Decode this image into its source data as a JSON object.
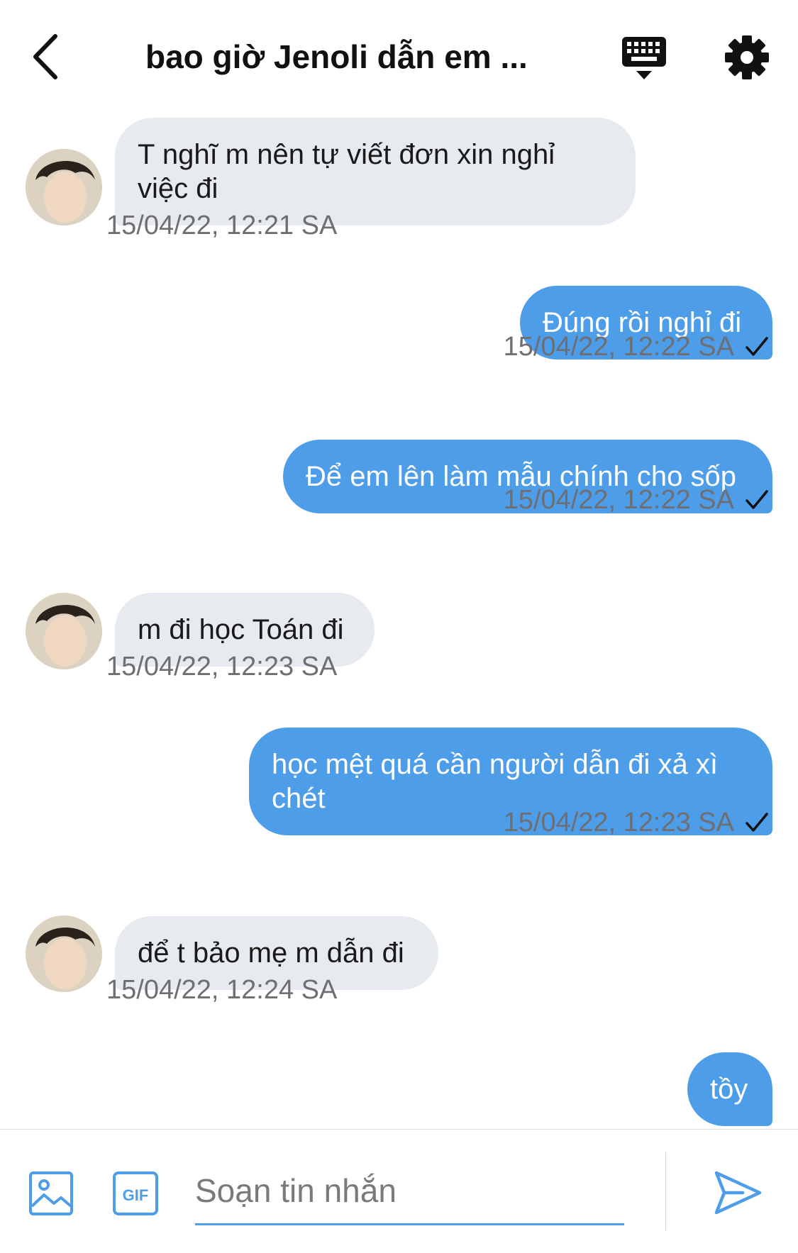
{
  "header": {
    "title": "bao giờ Jenoli dẫn em ...",
    "back_icon": "chevron-left-icon",
    "keyboard_icon": "keyboard-icon",
    "settings_icon": "gear-icon"
  },
  "messages": [
    {
      "direction": "in",
      "text": "T nghĩ m nên tự viết đơn xin nghỉ việc đi",
      "time": "15/04/22, 12:21 SA"
    },
    {
      "direction": "out",
      "text": "Đúng rồi nghỉ đi",
      "time": "15/04/22, 12:22 SA"
    },
    {
      "direction": "out",
      "text": "Để em lên làm mẫu chính cho sốp",
      "time": "15/04/22, 12:22 SA"
    },
    {
      "direction": "in",
      "text": "m đi học Toán đi",
      "time": "15/04/22, 12:23 SA"
    },
    {
      "direction": "out",
      "text": "học mệt quá cần người dẫn đi xả xì chét",
      "time": "15/04/22, 12:23 SA"
    },
    {
      "direction": "in",
      "text": "để t bảo mẹ m dẫn đi",
      "time": "15/04/22, 12:24 SA"
    },
    {
      "direction": "out",
      "text": "tồy",
      "time": ""
    }
  ],
  "composer": {
    "placeholder": "Soạn tin nhắn",
    "image_icon": "image-icon",
    "gif_label": "GIF",
    "send_icon": "send-icon"
  },
  "colors": {
    "outgoing_bubble": "#4d9de8",
    "incoming_bubble": "#e7eaee",
    "accent": "#4d9de8"
  }
}
